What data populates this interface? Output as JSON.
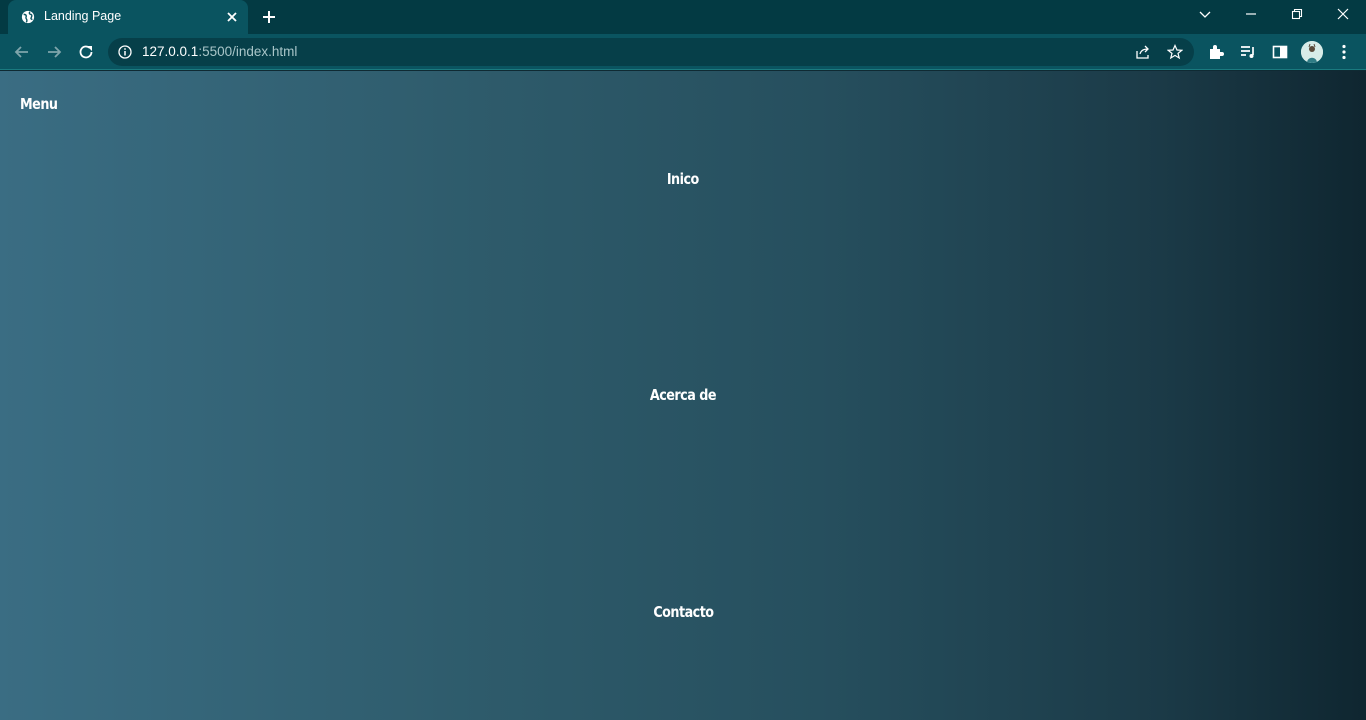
{
  "browser": {
    "tab": {
      "title": "Landing Page"
    },
    "address": {
      "host": "127.0.0.1",
      "path": ":5500/index.html"
    }
  },
  "page": {
    "menu_label": "Menu",
    "nav": [
      {
        "label": "Inico"
      },
      {
        "label": "Acerca de"
      },
      {
        "label": "Contacto"
      }
    ]
  },
  "colors": {
    "tabstrip": "#033a43",
    "toolbar": "#0a5460",
    "gradient_start": "#3a6d83",
    "gradient_end": "#0f2630",
    "text": "#ffffff"
  },
  "icons": {
    "tab_favicon": "globe-icon",
    "tab_close": "close-icon",
    "new_tab": "plus-icon",
    "tab_search": "chevron-down-icon",
    "minimize": "minimize-icon",
    "restore": "restore-icon",
    "close_window": "close-icon",
    "back": "back-arrow-icon",
    "forward": "forward-arrow-icon",
    "reload": "reload-icon",
    "site_info": "info-icon",
    "share": "share-icon",
    "bookmark": "star-icon",
    "extensions": "puzzle-icon",
    "media": "media-queue-icon",
    "side_panel": "side-panel-icon",
    "profile": "avatar",
    "more": "kebab-menu-icon"
  }
}
